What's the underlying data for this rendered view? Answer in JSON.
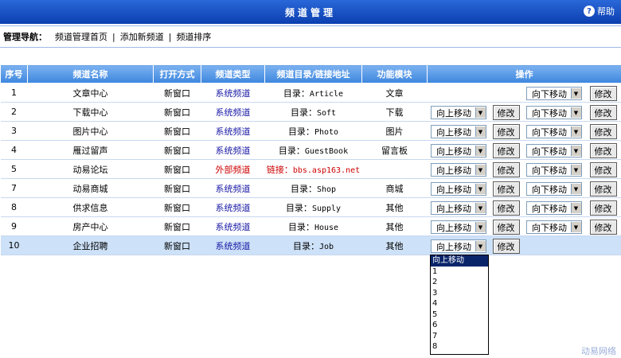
{
  "header": {
    "title": "频道管理",
    "help": "帮助",
    "help_icon": "help-icon"
  },
  "nav": {
    "label": "管理导航：",
    "links": [
      "频道管理首页",
      "添加新频道",
      "频道排序"
    ],
    "sep": "|"
  },
  "table": {
    "headers": [
      "序号",
      "频道名称",
      "打开方式",
      "频道类型",
      "频道目录/链接地址",
      "功能模块",
      "操作"
    ],
    "rows": [
      {
        "id": "1",
        "name": "文章中心",
        "open": "新窗口",
        "type": "系统频道",
        "dir_label": "目录：",
        "dir": "Article",
        "module": "文章",
        "up": "",
        "down": "向下移动"
      },
      {
        "id": "2",
        "name": "下载中心",
        "open": "新窗口",
        "type": "系统频道",
        "dir_label": "目录：",
        "dir": "Soft",
        "module": "下载",
        "up": "向上移动",
        "down": "向下移动"
      },
      {
        "id": "3",
        "name": "图片中心",
        "open": "新窗口",
        "type": "系统频道",
        "dir_label": "目录：",
        "dir": "Photo",
        "module": "图片",
        "up": "向上移动",
        "down": "向下移动"
      },
      {
        "id": "4",
        "name": "雁过留声",
        "open": "新窗口",
        "type": "系统频道",
        "dir_label": "目录：",
        "dir": "GuestBook",
        "module": "留言板",
        "up": "向上移动",
        "down": "向下移动"
      },
      {
        "id": "5",
        "name": "动易论坛",
        "open": "新窗口",
        "type": "外部频道",
        "dir_label": "链接：",
        "dir": "bbs.asp163.net",
        "module": "",
        "up": "向上移动",
        "down": "向下移动"
      },
      {
        "id": "7",
        "name": "动易商城",
        "open": "新窗口",
        "type": "系统频道",
        "dir_label": "目录：",
        "dir": "Shop",
        "module": "商城",
        "up": "向上移动",
        "down": "向下移动"
      },
      {
        "id": "8",
        "name": "供求信息",
        "open": "新窗口",
        "type": "系统频道",
        "dir_label": "目录：",
        "dir": "Supply",
        "module": "其他",
        "up": "向上移动",
        "down": "向下移动"
      },
      {
        "id": "9",
        "name": "房产中心",
        "open": "新窗口",
        "type": "系统频道",
        "dir_label": "目录：",
        "dir": "House",
        "module": "其他",
        "up": "向上移动",
        "down": "向下移动"
      },
      {
        "id": "10",
        "name": "企业招聘",
        "open": "新窗口",
        "type": "系统频道",
        "dir_label": "目录：",
        "dir": "Job",
        "module": "其他",
        "up": "向上移动",
        "down": ""
      }
    ],
    "modify": "修改"
  },
  "dropdown": {
    "options": [
      "向上移动",
      "1",
      "2",
      "3",
      "4",
      "5",
      "6",
      "7",
      "8"
    ],
    "selected": "向上移动"
  },
  "footer": {
    "brand": "动易网络"
  },
  "colors": {
    "accent": "#1b4fc4",
    "header_bg": "#3c86de",
    "selected_row": "#cde1f8",
    "external": "#cc0000",
    "system": "#1a1aa6"
  }
}
